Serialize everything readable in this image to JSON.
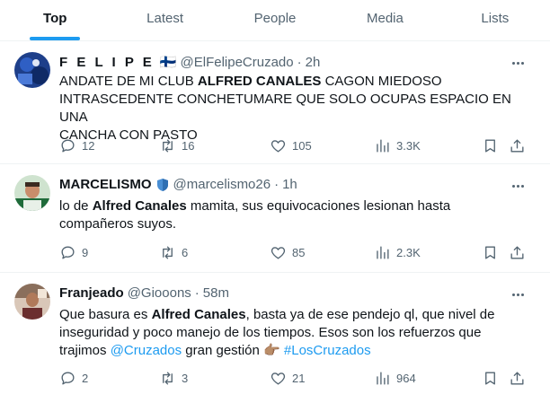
{
  "tabs": [
    "Top",
    "Latest",
    "People",
    "Media",
    "Lists"
  ],
  "tweets": [
    {
      "name": "F E L I P E",
      "flag": "🇫🇮",
      "handle": "@ElFelipeCruzado",
      "separator": "·",
      "time": "2h",
      "text": {
        "line1_pre": "ANDATE DE MI CLUB ",
        "line1_bold": "ALFRED CANALES",
        "line1_post": " CAGON MIEDOSO",
        "line2": "INTRASCEDENTE CONCHETUMARE QUE SOLO OCUPAS ESPACIO EN UNA",
        "line3": "CANCHA CON PASTO"
      },
      "replies": "12",
      "retweets": "16",
      "likes": "105",
      "views": "3.3K"
    },
    {
      "name": "MARCELISMO",
      "badge_icon": "shield-icon",
      "handle": "@marcelismo26",
      "separator": "·",
      "time": "1h",
      "text": {
        "pre": "lo de ",
        "bold": "Alfred Canales",
        "post": " mamita, sus equivocaciones lesionan hasta",
        "line2": "compañeros suyos."
      },
      "replies": "9",
      "retweets": "6",
      "likes": "85",
      "views": "2.3K"
    },
    {
      "name": "Franjeado",
      "handle": "@Giooons",
      "separator": "·",
      "time": "58m",
      "text": {
        "pre": "Que basura es ",
        "bold": "Alfred Canales",
        "post": ", basta ya de ese pendejo ql, que nivel de",
        "line2": "inseguridad y poco manejo de los tiempos. Esos son los refuerzos que",
        "line3_pre": "trajimos ",
        "mention": "@Cruzados",
        "line3_mid": " gran gestión ",
        "emoji": "👉🏽",
        "hashtag": "#LosCruzados"
      },
      "replies": "2",
      "retweets": "3",
      "likes": "21",
      "views": "964"
    }
  ],
  "colors": {
    "accent": "#1d9bf0",
    "muted": "#536471",
    "text": "#0f1419",
    "divider": "#eff3f4"
  }
}
